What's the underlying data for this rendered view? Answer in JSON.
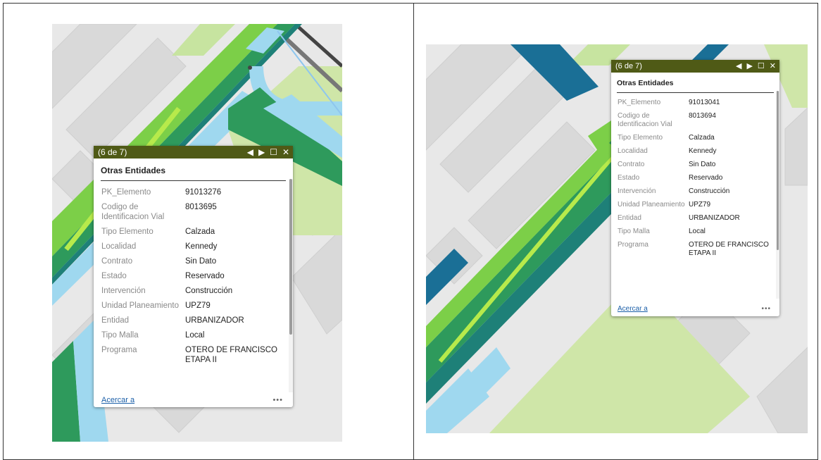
{
  "colors": {
    "popup_header": "#4f5a16",
    "link": "#1b5fa8",
    "map_background": "#e9e9e9"
  },
  "icons": {
    "prev": "◀",
    "next": "▶",
    "maximize": "☐",
    "close": "✕"
  },
  "left_popup": {
    "counter": "(6 de 7)",
    "title": "Otras Entidades",
    "fields": [
      {
        "key": "PK_Elemento",
        "value": "91013276"
      },
      {
        "key": "Codigo de Identificacion Vial",
        "value": "8013695"
      },
      {
        "key": "Tipo Elemento",
        "value": "Calzada"
      },
      {
        "key": "Localidad",
        "value": "Kennedy"
      },
      {
        "key": "Contrato",
        "value": "Sin Dato"
      },
      {
        "key": "Estado",
        "value": "Reservado"
      },
      {
        "key": "Intervención",
        "value": "Construcción"
      },
      {
        "key": "Unidad Planeamiento",
        "value": "UPZ79"
      },
      {
        "key": "Entidad",
        "value": "URBANIZADOR"
      },
      {
        "key": "Tipo Malla",
        "value": "Local"
      },
      {
        "key": "Programa",
        "value": "OTERO DE FRANCISCO ETAPA II"
      }
    ],
    "zoom_link": "Acercar a",
    "more": "•••"
  },
  "right_popup": {
    "counter": "(6 de 7)",
    "title": "Otras Entidades",
    "fields": [
      {
        "key": "PK_Elemento",
        "value": "91013041"
      },
      {
        "key": "Codigo de Identificacion Vial",
        "value": "8013694"
      },
      {
        "key": "Tipo Elemento",
        "value": "Calzada"
      },
      {
        "key": "Localidad",
        "value": "Kennedy"
      },
      {
        "key": "Contrato",
        "value": "Sin Dato"
      },
      {
        "key": "Estado",
        "value": "Reservado"
      },
      {
        "key": "Intervención",
        "value": "Construcción"
      },
      {
        "key": "Unidad Planeamiento",
        "value": "UPZ79"
      },
      {
        "key": "Entidad",
        "value": "URBANIZADOR"
      },
      {
        "key": "Tipo Malla",
        "value": "Local"
      },
      {
        "key": "Programa",
        "value": "OTERO DE FRANCISCO ETAPA II"
      }
    ],
    "zoom_link": "Acercar a",
    "more": "•••"
  }
}
